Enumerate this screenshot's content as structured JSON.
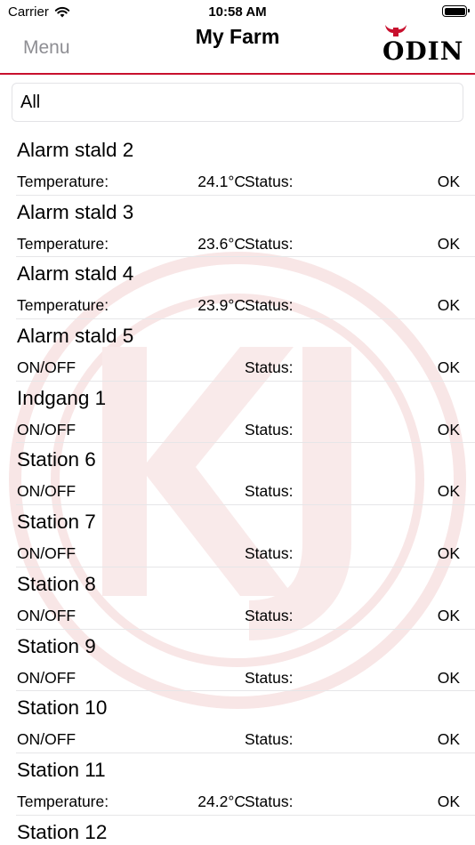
{
  "status_bar": {
    "carrier": "Carrier",
    "time": "10:58 AM"
  },
  "nav": {
    "menu_label": "Menu",
    "title": "My Farm",
    "logo_text": "ODIN"
  },
  "filter": {
    "value": "All"
  },
  "colors": {
    "accent": "#c8102e",
    "menu_gray": "#8e8e93",
    "watermark": "#f7e3e3"
  },
  "rows": [
    {
      "name": "Alarm stald 2",
      "label": "Temperature:",
      "value": "24.1°C",
      "status_label": "Status:",
      "status": "OK"
    },
    {
      "name": "Alarm stald 3",
      "label": "Temperature:",
      "value": "23.6°C",
      "status_label": "Status:",
      "status": "OK"
    },
    {
      "name": "Alarm stald 4",
      "label": "Temperature:",
      "value": "23.9°C",
      "status_label": "Status:",
      "status": "OK"
    },
    {
      "name": "Alarm stald 5",
      "label": "ON/OFF",
      "value": "",
      "status_label": "Status:",
      "status": "OK"
    },
    {
      "name": "Indgang 1",
      "label": "ON/OFF",
      "value": "",
      "status_label": "Status:",
      "status": "OK"
    },
    {
      "name": "Station 6",
      "label": "ON/OFF",
      "value": "",
      "status_label": "Status:",
      "status": "OK"
    },
    {
      "name": "Station 7",
      "label": "ON/OFF",
      "value": "",
      "status_label": "Status:",
      "status": "OK"
    },
    {
      "name": "Station 8",
      "label": "ON/OFF",
      "value": "",
      "status_label": "Status:",
      "status": "OK"
    },
    {
      "name": "Station 9",
      "label": "ON/OFF",
      "value": "",
      "status_label": "Status:",
      "status": "OK"
    },
    {
      "name": "Station 10",
      "label": "ON/OFF",
      "value": "",
      "status_label": "Status:",
      "status": "OK"
    },
    {
      "name": "Station 11",
      "label": "Temperature:",
      "value": "24.2°C",
      "status_label": "Status:",
      "status": "OK"
    },
    {
      "name": "Station 12",
      "label": "",
      "value": "",
      "status_label": "",
      "status": ""
    }
  ]
}
